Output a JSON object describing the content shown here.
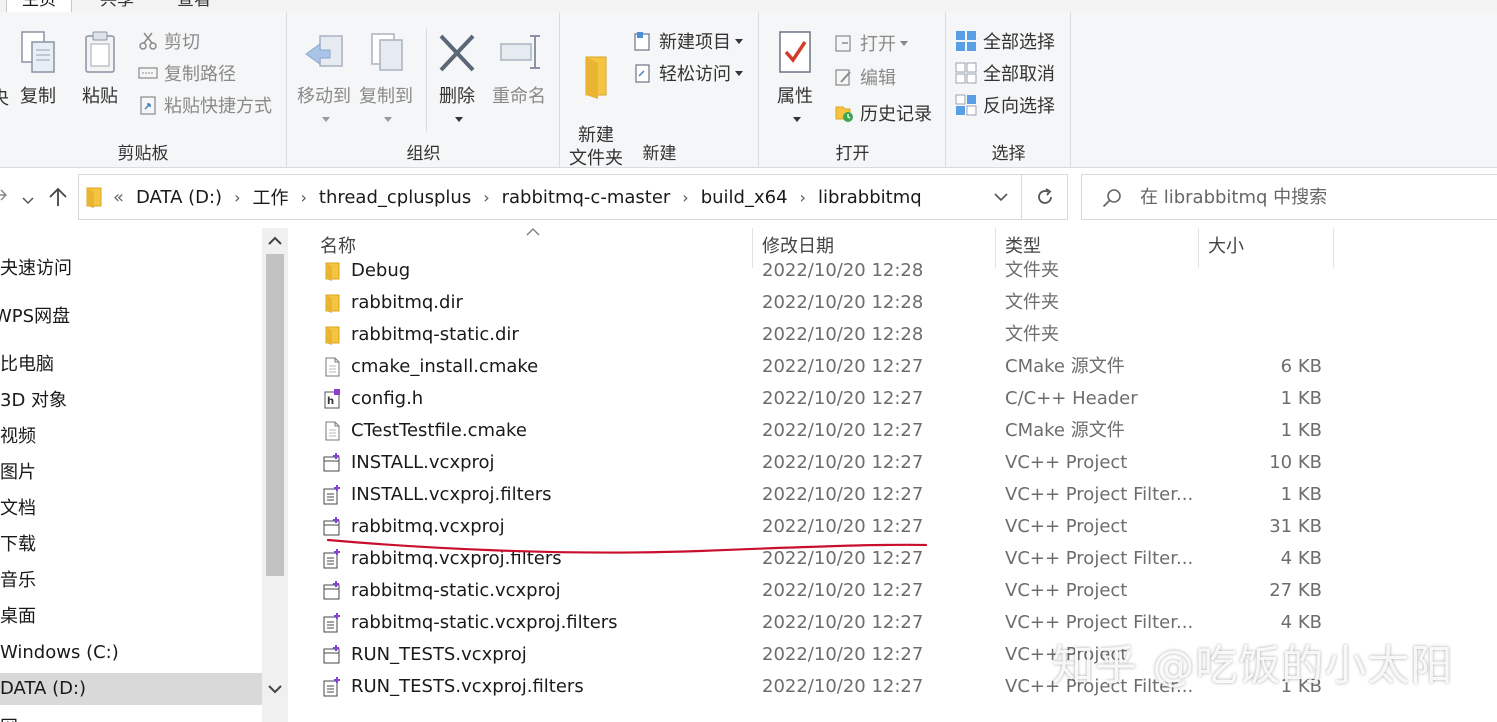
{
  "tabs": [
    "主页",
    "共享",
    "查看"
  ],
  "ribbon": {
    "clipboard": {
      "label": "剪贴板",
      "cut_partial": "央",
      "copy": "复制",
      "paste": "粘贴",
      "cut": "剪切",
      "copy_path": "复制路径",
      "paste_shortcut": "粘贴快捷方式"
    },
    "organize": {
      "label": "组织",
      "move_to": "移动到",
      "copy_to": "复制到",
      "delete": "删除",
      "rename": "重命名"
    },
    "new": {
      "label": "新建",
      "new_folder": "新建\n文件夹",
      "new_item": "新建项目",
      "easy_access": "轻松访问"
    },
    "open": {
      "label": "打开",
      "properties": "属性",
      "open": "打开",
      "edit": "编辑",
      "history": "历史记录"
    },
    "select": {
      "label": "选择",
      "select_all": "全部选择",
      "select_none": "全部取消",
      "invert": "反向选择"
    }
  },
  "address": {
    "overflow": "«",
    "crumbs": [
      "DATA (D:)",
      "工作",
      "thread_cplusplus",
      "rabbitmq-c-master",
      "build_x64",
      "librabbitmq"
    ]
  },
  "search": {
    "placeholder": "在 librabbitmq 中搜索"
  },
  "nav_pane": {
    "items": [
      "夬速访问",
      "WPS网盘",
      "比电脑",
      "3D 对象",
      "视频",
      "图片",
      "文档",
      "下载",
      "音乐",
      "桌面",
      "Windows (C:)",
      "DATA (D:)",
      "网"
    ],
    "selected_index": 11
  },
  "columns": {
    "name": "名称",
    "date": "修改日期",
    "type": "类型",
    "size": "大小"
  },
  "files": [
    {
      "name": "Debug",
      "date": "2022/10/20 12:28",
      "type": "文件夹",
      "size": "",
      "icon": "folder-icon"
    },
    {
      "name": "rabbitmq.dir",
      "date": "2022/10/20 12:28",
      "type": "文件夹",
      "size": "",
      "icon": "folder-icon"
    },
    {
      "name": "rabbitmq-static.dir",
      "date": "2022/10/20 12:28",
      "type": "文件夹",
      "size": "",
      "icon": "folder-icon"
    },
    {
      "name": "cmake_install.cmake",
      "date": "2022/10/20 12:27",
      "type": "CMake 源文件",
      "size": "6 KB",
      "icon": "document-icon"
    },
    {
      "name": "config.h",
      "date": "2022/10/20 12:27",
      "type": "C/C++ Header",
      "size": "1 KB",
      "icon": "header-file-icon"
    },
    {
      "name": "CTestTestfile.cmake",
      "date": "2022/10/20 12:27",
      "type": "CMake 源文件",
      "size": "1 KB",
      "icon": "document-icon"
    },
    {
      "name": "INSTALL.vcxproj",
      "date": "2022/10/20 12:27",
      "type": "VC++ Project",
      "size": "10 KB",
      "icon": "vcxproj-icon"
    },
    {
      "name": "INSTALL.vcxproj.filters",
      "date": "2022/10/20 12:27",
      "type": "VC++ Project Filter...",
      "size": "1 KB",
      "icon": "filters-file-icon"
    },
    {
      "name": "rabbitmq.vcxproj",
      "date": "2022/10/20 12:27",
      "type": "VC++ Project",
      "size": "31 KB",
      "icon": "vcxproj-icon"
    },
    {
      "name": "rabbitmq.vcxproj.filters",
      "date": "2022/10/20 12:27",
      "type": "VC++ Project Filter...",
      "size": "4 KB",
      "icon": "filters-file-icon"
    },
    {
      "name": "rabbitmq-static.vcxproj",
      "date": "2022/10/20 12:27",
      "type": "VC++ Project",
      "size": "27 KB",
      "icon": "vcxproj-icon"
    },
    {
      "name": "rabbitmq-static.vcxproj.filters",
      "date": "2022/10/20 12:27",
      "type": "VC++ Project Filter...",
      "size": "4 KB",
      "icon": "filters-file-icon"
    },
    {
      "name": "RUN_TESTS.vcxproj",
      "date": "2022/10/20 12:27",
      "type": "VC++ Project",
      "size": "",
      "icon": "vcxproj-icon"
    },
    {
      "name": "RUN_TESTS.vcxproj.filters",
      "date": "2022/10/20 12:27",
      "type": "VC++ Project Filter...",
      "size": "1 KB",
      "icon": "filters-file-icon"
    }
  ],
  "watermark": "知乎 @吃饭的小太阳",
  "colors": {
    "accent": "#1979ca",
    "annotation": "#c8102e",
    "folder": "#f5c542"
  }
}
